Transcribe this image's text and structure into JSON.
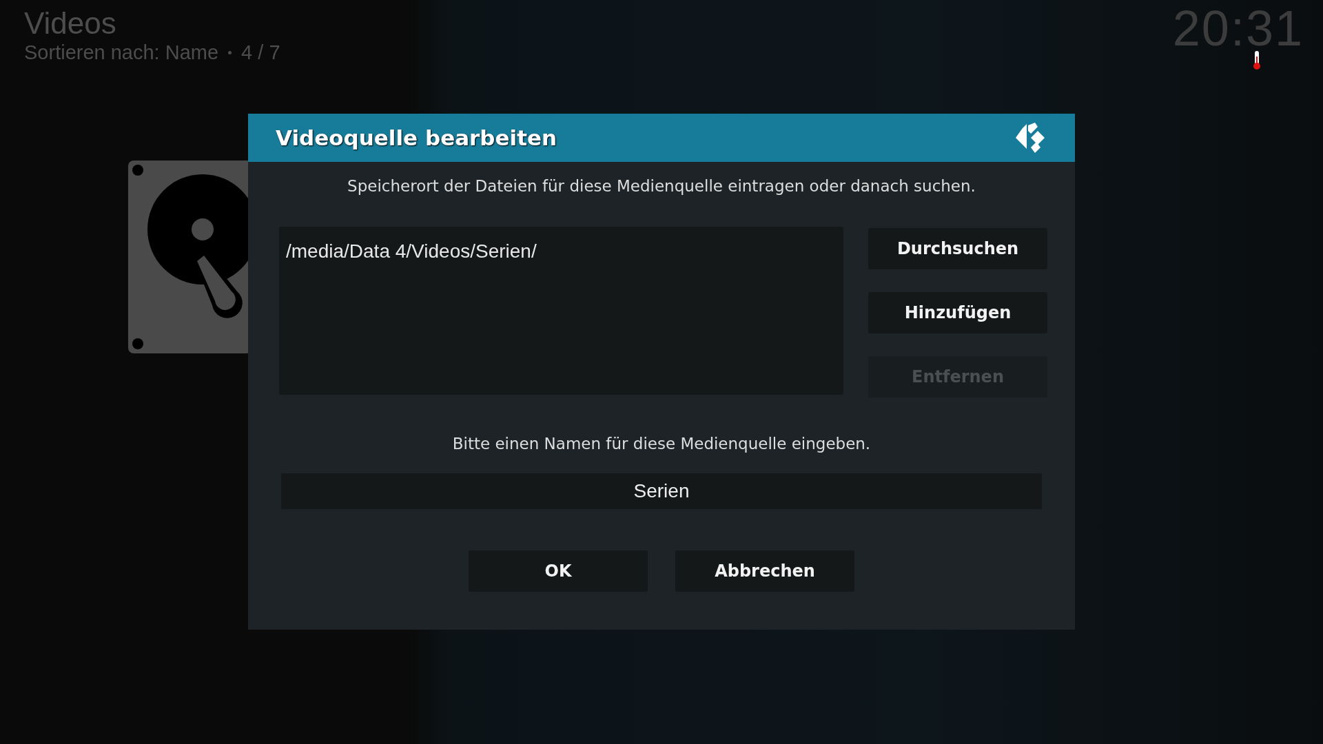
{
  "header": {
    "title": "Videos",
    "sort_label": "Sortieren nach: Name",
    "position": "4 / 7"
  },
  "clock": {
    "time": "20:31"
  },
  "dialog": {
    "title": "Videoquelle bearbeiten",
    "description": "Speicherort der Dateien für diese Medienquelle eintragen oder danach suchen.",
    "paths": [
      {
        "text": "/media/Data 4/Videos/Serien/"
      }
    ],
    "side_buttons": [
      {
        "label": "Durchsuchen",
        "disabled": false
      },
      {
        "label": "Hinzufügen",
        "disabled": false
      },
      {
        "label": "Entfernen",
        "disabled": true
      }
    ],
    "name_prompt": "Bitte einen Namen für diese Medienquelle eingeben.",
    "name_field": {
      "value": "Serien"
    },
    "actions": [
      {
        "label": "OK"
      },
      {
        "label": "Abbrechen"
      }
    ]
  }
}
